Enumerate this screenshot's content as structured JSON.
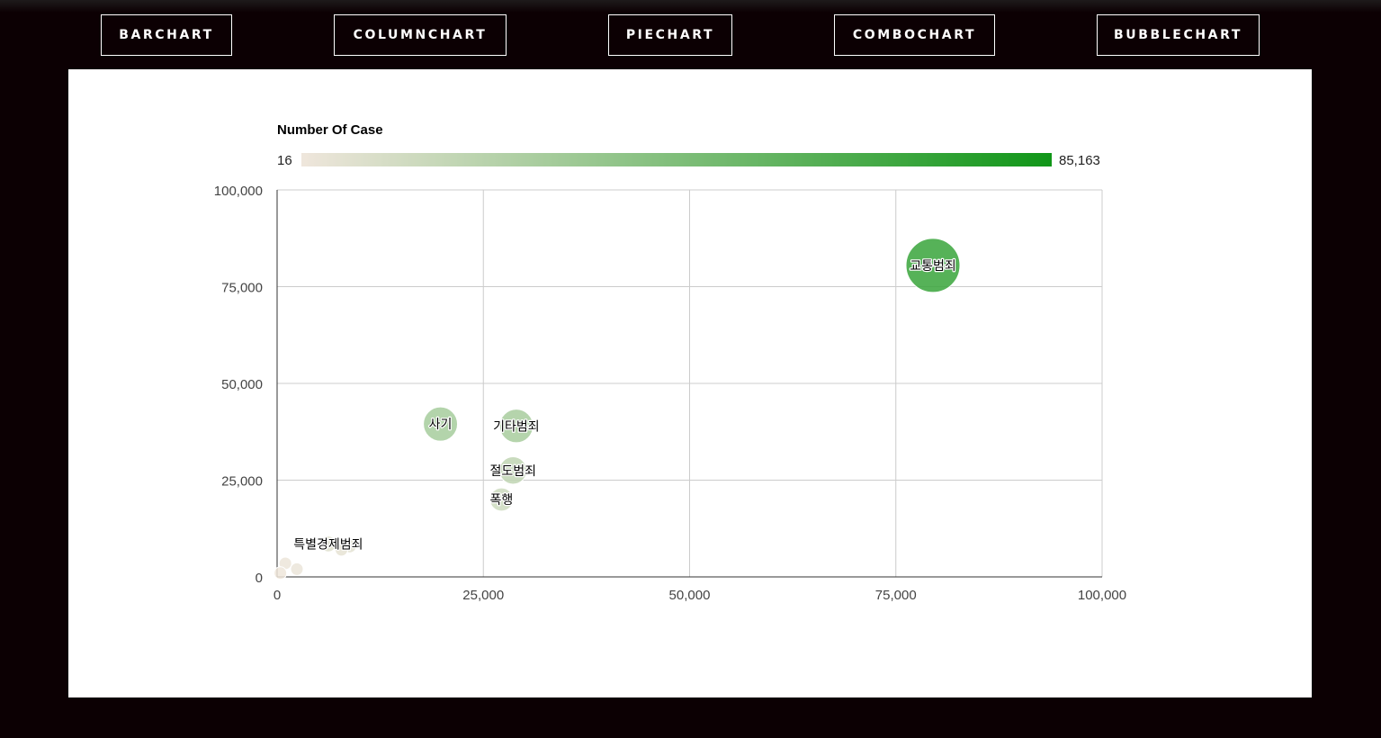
{
  "nav": {
    "buttons": [
      {
        "label": "BARCHART"
      },
      {
        "label": "COLUMNCHART"
      },
      {
        "label": "PIECHART"
      },
      {
        "label": "COMBOCHART"
      },
      {
        "label": "BUBBLECHART"
      }
    ]
  },
  "chart_data": {
    "type": "scatter",
    "colorbar": {
      "title": "Number Of Case",
      "min": 16,
      "max": 85163,
      "min_label": "16",
      "max_label": "85,163",
      "colors": [
        "#efe6dc",
        "#109618"
      ]
    },
    "xlim": [
      0,
      100000
    ],
    "ylim": [
      0,
      100000
    ],
    "x_ticks": [
      0,
      25000,
      50000,
      75000,
      100000
    ],
    "y_ticks": [
      0,
      25000,
      50000,
      75000,
      100000
    ],
    "x_tick_labels": [
      "0",
      "25,000",
      "50,000",
      "75,000",
      "100,000"
    ],
    "y_tick_labels": [
      "0",
      "25,000",
      "50,000",
      "75,000",
      "100,000"
    ],
    "grid": true,
    "legend": "top",
    "points": [
      {
        "label": "교통범죄",
        "x": 79500,
        "y": 80500,
        "value": 70000
      },
      {
        "label": "사기",
        "x": 19800,
        "y": 39500,
        "value": 28000
      },
      {
        "label": "기타범죄",
        "x": 29000,
        "y": 39000,
        "value": 27000
      },
      {
        "label": "절도범죄",
        "x": 28600,
        "y": 27500,
        "value": 18000
      },
      {
        "label": "폭행",
        "x": 27200,
        "y": 20000,
        "value": 13000
      },
      {
        "label": "특별경제범죄",
        "x": 6200,
        "y": 8500,
        "value": 6000
      },
      {
        "label": "",
        "x": 8800,
        "y": 8000,
        "value": 4500
      },
      {
        "label": "",
        "x": 7800,
        "y": 7000,
        "value": 3500
      },
      {
        "label": "",
        "x": 2400,
        "y": 2000,
        "value": 1500
      },
      {
        "label": "",
        "x": 1000,
        "y": 3500,
        "value": 1200
      },
      {
        "label": "",
        "x": 400,
        "y": 1000,
        "value": 500
      }
    ]
  }
}
